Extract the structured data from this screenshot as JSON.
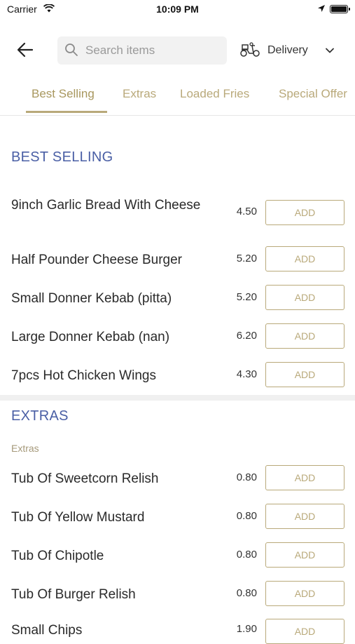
{
  "status": {
    "carrier": "Carrier",
    "time": "10:09 PM"
  },
  "header": {
    "search_placeholder": "Search items",
    "delivery_label": "Delivery"
  },
  "tabs": [
    "Best Selling",
    "Extras",
    "Loaded Fries",
    "Special Offer"
  ],
  "sections": {
    "best_selling": {
      "title": "BEST SELLING",
      "items": [
        {
          "name": "9inch Garlic Bread With Cheese",
          "price": "4.50",
          "button": "ADD"
        },
        {
          "name": "Half Pounder Cheese Burger",
          "price": "5.20",
          "button": "ADD"
        },
        {
          "name": "Small Donner Kebab (pitta)",
          "price": "5.20",
          "button": "ADD"
        },
        {
          "name": "Large Donner Kebab (nan)",
          "price": "6.20",
          "button": "ADD"
        },
        {
          "name": "7pcs Hot Chicken Wings",
          "price": "4.30",
          "button": "ADD"
        }
      ]
    },
    "extras": {
      "title": "EXTRAS",
      "subtitle": "Extras",
      "items": [
        {
          "name": "Tub Of Sweetcorn Relish",
          "price": "0.80",
          "button": "ADD"
        },
        {
          "name": "Tub Of Yellow Mustard",
          "price": "0.80",
          "button": "ADD"
        },
        {
          "name": "Tub Of Chipotle",
          "price": "0.80",
          "button": "ADD"
        },
        {
          "name": "Tub Of Burger Relish",
          "price": "0.80",
          "button": "ADD"
        },
        {
          "name": "Small Chips",
          "price": "1.90",
          "button": "ADD"
        }
      ]
    }
  },
  "colors": {
    "accent": "#b9a97a",
    "section_title": "#4a5fa5"
  },
  "icons": [
    "wifi-icon",
    "location-arrow-icon",
    "battery-icon",
    "back-arrow-icon",
    "search-icon",
    "delivery-scooter-icon",
    "chevron-down-icon"
  ]
}
